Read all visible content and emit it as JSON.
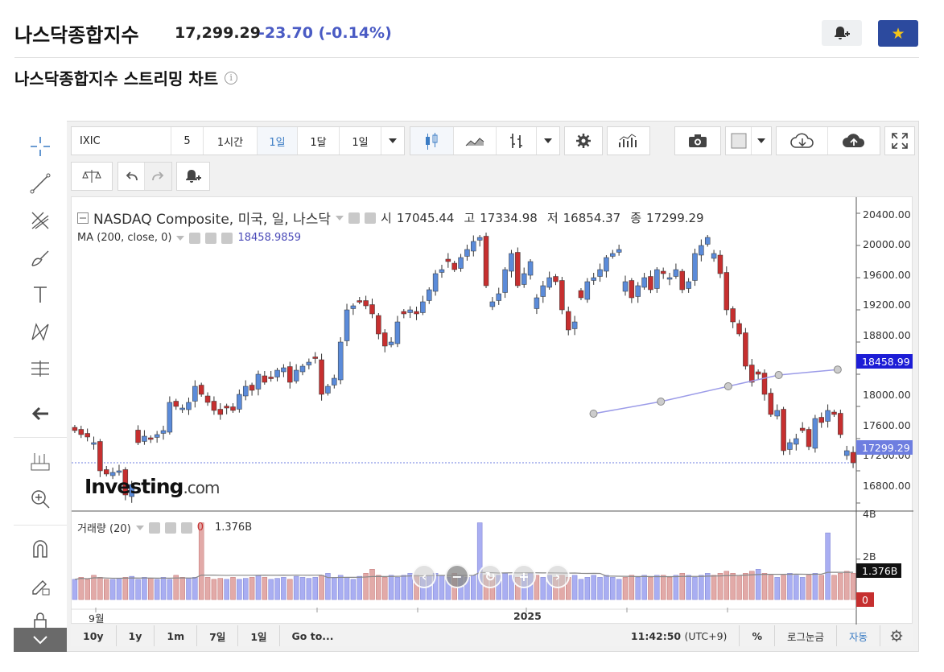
{
  "header": {
    "title": "나스닥종합지수",
    "price": "17,299.29",
    "change": "-23.70",
    "change_pct": "(-0.14%)",
    "alert_icon": "bell-plus-icon",
    "star_icon": "star-icon"
  },
  "subtitle": "나스닥종합지수 스트리밍 차트",
  "toolbar": {
    "symbol": "IXIC",
    "intervals": [
      "5",
      "1시간",
      "1일",
      "1달",
      "1일"
    ],
    "active_interval": "1일"
  },
  "legend": {
    "name": "NASDAQ Composite, 미국, 일, 나스닥",
    "open_label": "시",
    "open": "17045.44",
    "high_label": "고",
    "high": "17334.98",
    "low_label": "저",
    "low": "16854.37",
    "close_label": "종",
    "close": "17299.29",
    "ma_label": "MA (200, close, 0)",
    "ma_value": "18458.9859",
    "vol_label": "거래량 (20)",
    "vol_zero": "0",
    "vol_value": "1.376B"
  },
  "y_axis": {
    "labels": [
      "20400.00",
      "20000.00",
      "19600.00",
      "19200.00",
      "18800.00",
      "18000.00",
      "17600.00",
      "17200.00",
      "16800.00"
    ],
    "ma_tag": "18458.99",
    "price_tag": "17299.29",
    "vol_labels": [
      "4B",
      "2B"
    ],
    "vol_tag": "1.376B",
    "vol_zero_tag": "0"
  },
  "x_axis": {
    "labels": [
      "9월",
      "2025"
    ]
  },
  "watermark": {
    "brand": "Investing",
    "suffix": ".com"
  },
  "bottombar": {
    "ranges": [
      "10y",
      "1y",
      "1m",
      "7일",
      "1일"
    ],
    "goto": "Go to...",
    "time": "11:42:50",
    "tz": "(UTC+9)",
    "pct": "%",
    "log": "로그눈금",
    "auto": "자동"
  },
  "colors": {
    "up": "#5b8bd9",
    "down": "#c62f2f",
    "accent": "#2c4a9e",
    "ma": "#9b9be8",
    "change": "#4a5bc4"
  },
  "chart_data": {
    "type": "candlestick",
    "title": "NASDAQ Composite, 미국, 일, 나스닥",
    "ylim": [
      16700,
      20600
    ],
    "closes": [
      17700,
      17650,
      17620,
      17550,
      17200,
      17160,
      17180,
      17200,
      16900,
      17030,
      17550,
      17630,
      17600,
      17650,
      17700,
      18050,
      18000,
      17980,
      18050,
      18250,
      18150,
      18050,
      17950,
      17900,
      17980,
      17950,
      18150,
      18250,
      18200,
      18400,
      18300,
      18350,
      18450,
      18480,
      18300,
      18450,
      18500,
      18550,
      18600,
      18150,
      18250,
      18350,
      18800,
      19200,
      19250,
      19300,
      19250,
      19150,
      18900,
      18750,
      18800,
      19050,
      19150,
      19200,
      19150,
      19300,
      19450,
      19650,
      19700,
      19800,
      19700,
      19850,
      19950,
      20050,
      20100,
      19500,
      19300,
      19400,
      19700,
      19900,
      19500,
      19650,
      19800,
      19350,
      19500,
      19600,
      19550,
      19200,
      18950,
      19050,
      19350,
      19550,
      19600,
      19700,
      19850,
      19900,
      19950,
      19550,
      19350,
      19500,
      19600,
      19450,
      19700,
      19650,
      19600,
      19700,
      19450,
      19550,
      19900,
      20000,
      20100,
      19900,
      19650,
      19200,
      19050,
      18900,
      18500,
      18300,
      18400,
      18150,
      17900,
      17950,
      17450,
      17550,
      17600,
      17700,
      17500,
      17850,
      17800,
      17950,
      17900,
      17650,
      17450,
      17300
    ],
    "ma200": [
      [
        0.62,
        17910
      ],
      [
        0.7,
        18060
      ],
      [
        0.78,
        18250
      ],
      [
        0.84,
        18390
      ],
      [
        0.91,
        18458
      ]
    ],
    "volume_b": [
      1.0,
      1.1,
      1.0,
      1.2,
      1.1,
      1.0,
      1.0,
      1.05,
      1.1,
      1.15,
      1.0,
      1.1,
      1.05,
      1.0,
      1.1,
      1.0,
      1.2,
      1.1,
      1.05,
      1.1,
      3.8,
      1.1,
      1.0,
      1.05,
      1.0,
      1.1,
      1.0,
      1.05,
      1.1,
      1.2,
      1.1,
      1.0,
      1.05,
      1.1,
      1.0,
      1.15,
      1.1,
      1.05,
      1.1,
      1.2,
      1.3,
      1.1,
      1.2,
      1.1,
      1.0,
      1.15,
      1.3,
      1.5,
      1.2,
      1.1,
      1.2,
      1.1,
      1.2,
      1.3,
      1.2,
      1.1,
      1.2,
      1.3,
      1.2,
      1.1,
      1.3,
      1.2,
      1.1,
      1.2,
      3.8,
      1.2,
      1.1,
      1.2,
      1.3,
      1.2,
      1.1,
      1.2,
      1.3,
      1.2,
      1.1,
      1.2,
      1.1,
      1.2,
      1.1,
      1.2,
      1.0,
      1.1,
      1.2,
      1.1,
      1.2,
      1.1,
      1.0,
      1.1,
      1.2,
      1.1,
      1.2,
      1.1,
      1.2,
      1.2,
      1.1,
      1.2,
      1.3,
      1.2,
      1.1,
      1.2,
      1.3,
      1.2,
      1.3,
      1.4,
      1.3,
      1.2,
      1.3,
      1.4,
      1.5,
      1.3,
      1.2,
      1.1,
      1.2,
      1.3,
      1.2,
      1.1,
      1.2,
      1.3,
      1.2,
      3.3,
      1.2,
      1.3,
      1.4,
      1.3
    ],
    "vol_ylim": [
      0,
      4.3
    ]
  }
}
